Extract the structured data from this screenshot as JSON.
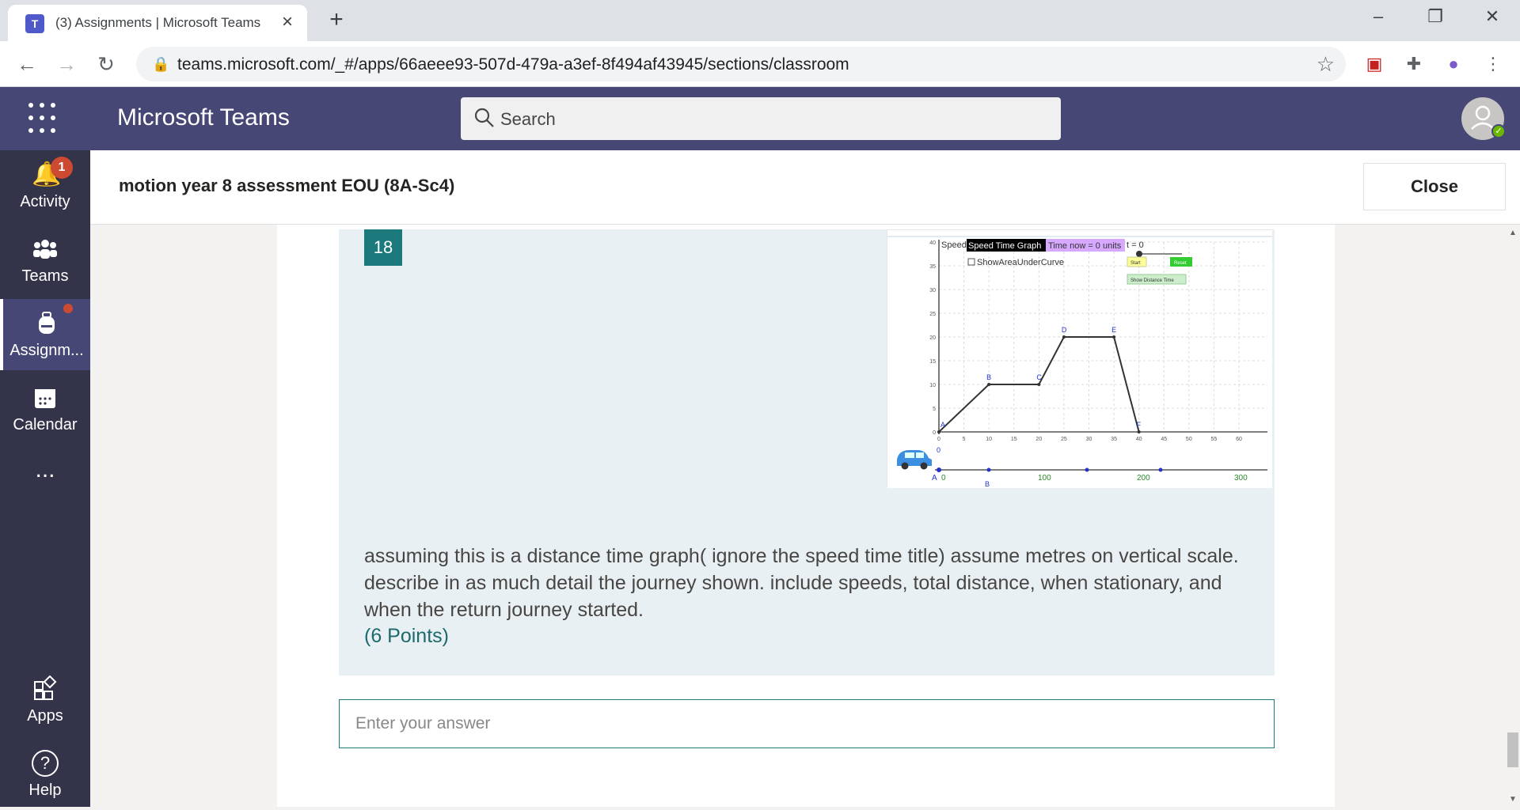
{
  "browser": {
    "tab_title": "(3) Assignments | Microsoft Teams",
    "url": "teams.microsoft.com/_#/apps/66aeee93-507d-479a-a3ef-8f494af43945/sections/classroom"
  },
  "teams": {
    "app_title": "Microsoft Teams",
    "search_placeholder": "Search"
  },
  "rail": {
    "activity": {
      "label": "Activity",
      "badge": "1"
    },
    "teams": {
      "label": "Teams"
    },
    "assignments": {
      "label": "Assignm..."
    },
    "calendar": {
      "label": "Calendar"
    },
    "more": {
      "label": "..."
    },
    "apps": {
      "label": "Apps"
    },
    "help": {
      "label": "Help"
    }
  },
  "page": {
    "title": "motion year 8 assessment EOU (8A-Sc4)",
    "close_label": "Close"
  },
  "question": {
    "number": "18",
    "text": "assuming this is a distance time graph( ignore the speed time title) assume metres on vertical scale. describe in as much detail the journey shown. include speeds, total distance, when stationary, and when the return journey started.",
    "points": "(6 Points)",
    "answer_placeholder": "Enter your answer"
  },
  "graph": {
    "y_label": "Speed",
    "title_box": "Speed Time Graph",
    "time_now": "Time now = 0 units",
    "t_label": "t = 0",
    "checkbox_label": "ShowAreaUnderCurve",
    "start_label": "Start",
    "reset_label": "Reset",
    "show_distance_label": "Show Distance Time",
    "y_ticks": [
      "0",
      "5",
      "10",
      "15",
      "20",
      "25",
      "30",
      "35",
      "40"
    ],
    "x_ticks": [
      "0",
      "5",
      "10",
      "15",
      "20",
      "25",
      "30",
      "35",
      "40",
      "45",
      "50",
      "55",
      "60"
    ],
    "line_ticks": [
      "0",
      "100",
      "200",
      "300"
    ],
    "point_labels": [
      "A",
      "B",
      "C",
      "D",
      "E",
      "F",
      "O"
    ]
  },
  "chart_data": {
    "type": "line",
    "x": [
      0,
      10,
      20,
      25,
      35,
      40
    ],
    "y": [
      0,
      10,
      10,
      20,
      20,
      0
    ],
    "point_labels": [
      "A",
      "B",
      "C",
      "D",
      "E",
      "F"
    ],
    "xlim": [
      0,
      60
    ],
    "ylim": [
      0,
      40
    ],
    "grid": true
  }
}
